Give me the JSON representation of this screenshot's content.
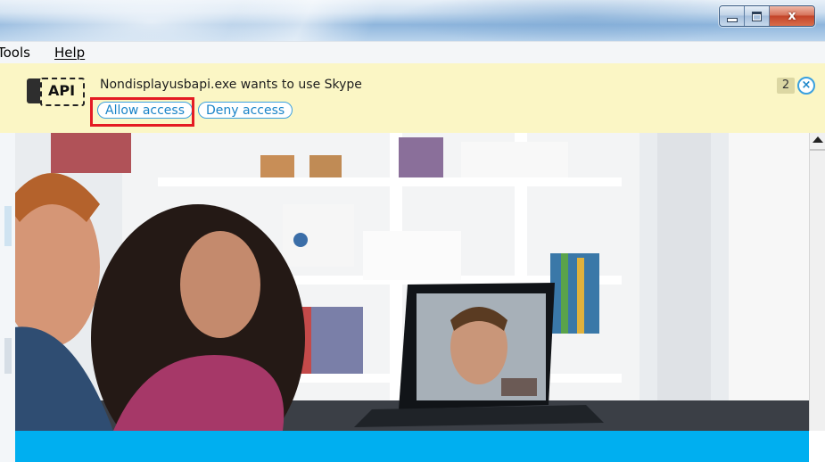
{
  "window": {
    "controls": {
      "minimize_icon": "minimize-icon",
      "maximize_icon": "maximize-icon",
      "close_label": "x"
    }
  },
  "menu": {
    "items": [
      {
        "label": "Tools",
        "visible_label": "Tools"
      },
      {
        "label": "Help"
      }
    ]
  },
  "notification": {
    "icon_label": "API",
    "message": "Nondisplayusbapi.exe wants to use Skype",
    "allow_label": "Allow access",
    "deny_label": "Deny access",
    "count": "2",
    "close_glyph": "×",
    "highlight_color": "#e41b23",
    "background_color": "#fbf6c5",
    "link_color": "#1a84c8"
  },
  "hero": {
    "image": "people-video-call-photo",
    "band_color": "#00aff0"
  }
}
